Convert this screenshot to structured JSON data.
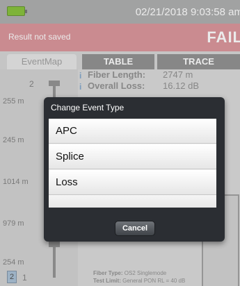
{
  "status_bar": {
    "datetime": "02/21/2018 9:03:58 am"
  },
  "banner": {
    "result": "Result not saved",
    "status": "FAIL"
  },
  "tabs": [
    {
      "label": "EventMap"
    },
    {
      "label": "TABLE"
    },
    {
      "label": "TRACE"
    }
  ],
  "event_map": {
    "top_number": "2",
    "distances": [
      "255 m",
      "245 m",
      "1014 m",
      "979 m",
      "254 m"
    ],
    "bottom_numbers": [
      "2",
      "1"
    ]
  },
  "details": {
    "fiber_length_label": "Fiber Length:",
    "fiber_length_value": "2747 m",
    "overall_loss_label": "Overall Loss:",
    "overall_loss_value": "16.12 dB",
    "fiber_type_label": "Fiber Type:",
    "fiber_type_value": "OS2 Singlemode",
    "test_limit_label": "Test Limit:",
    "test_limit_value": "General PON RL = 40 dB"
  },
  "dialog": {
    "title": "Change Event Type",
    "options": [
      {
        "label": "APC"
      },
      {
        "label": "Splice"
      },
      {
        "label": "Loss"
      }
    ],
    "cancel_label": "Cancel"
  },
  "colors": {
    "fail_banner": "#d98f95",
    "battery": "#7fbe2e",
    "dialog_bg": "#2b2e33",
    "info_icon": "#7aa2c8"
  }
}
